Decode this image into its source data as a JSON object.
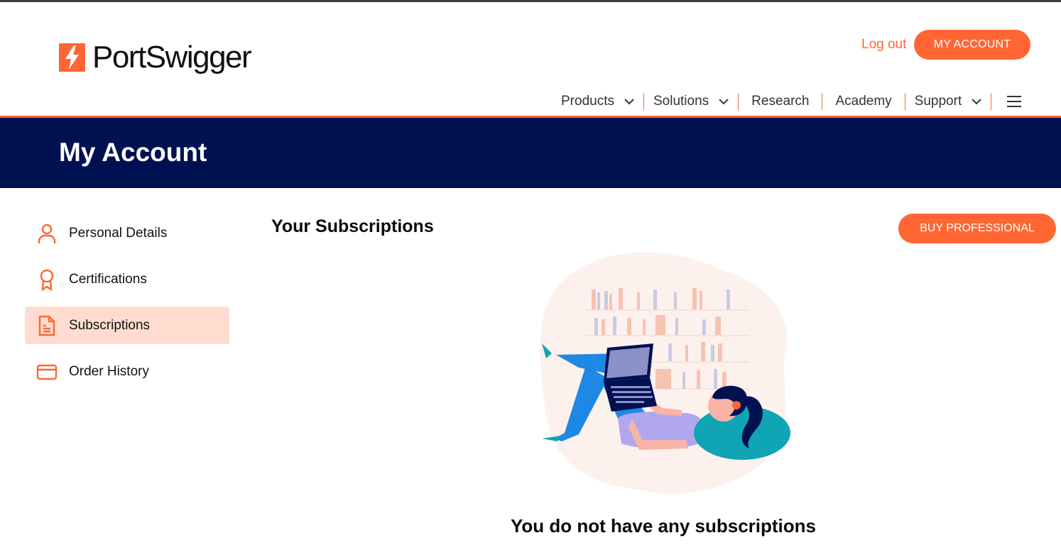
{
  "header": {
    "brand": "PortSwigger",
    "logout_label": "Log out",
    "my_account_label": "MY ACCOUNT"
  },
  "nav": {
    "items": [
      {
        "label": "Products",
        "has_dropdown": true
      },
      {
        "label": "Solutions",
        "has_dropdown": true
      },
      {
        "label": "Research",
        "has_dropdown": false
      },
      {
        "label": "Academy",
        "has_dropdown": false
      },
      {
        "label": "Support",
        "has_dropdown": true
      }
    ],
    "menu_icon": "hamburger-icon"
  },
  "banner": {
    "title": "My Account"
  },
  "sidebar": {
    "items": [
      {
        "label": "Personal Details",
        "icon": "user-icon",
        "active": false
      },
      {
        "label": "Certifications",
        "icon": "award-ribbon-icon",
        "active": false
      },
      {
        "label": "Subscriptions",
        "icon": "document-icon",
        "active": true
      },
      {
        "label": "Order History",
        "icon": "credit-card-icon",
        "active": false
      }
    ]
  },
  "main": {
    "title": "Your Subscriptions",
    "buy_label": "BUY PROFESSIONAL",
    "empty_message": "You do not have any subscriptions",
    "illustration": "person-reading-laptop-illustration"
  },
  "colors": {
    "accent": "#ff6633",
    "banner": "#001152",
    "active_item_bg": "#ffdccf"
  }
}
